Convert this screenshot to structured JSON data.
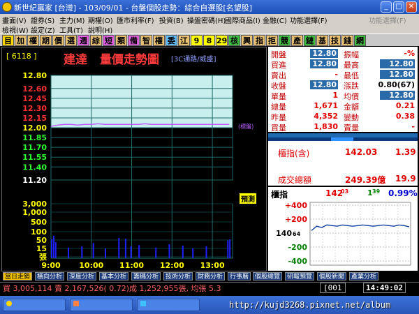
{
  "window": {
    "title": "新世紀贏家 [台灣] - 103/09/01 - 台盤個股走勢：綜合自選股[名望股]"
  },
  "menu_row1": {
    "items": [
      "畫面(V)",
      "證券(S)",
      "主力(M)",
      "期權(O)",
      "匯市利率(F)",
      "投資(B)",
      "操盤密碼(H)",
      "國際商品(I)",
      "金融(C)",
      "功能選擇(F)",
      "功能選擇(F)"
    ]
  },
  "menu_row2": {
    "items": [
      "檢視(W)",
      "設定(Z)",
      "工具(T)",
      "說明(H)"
    ]
  },
  "toolbar": {
    "buttons": [
      "目",
      "加",
      "權",
      "期",
      "價",
      "選",
      "週",
      "綜",
      "短",
      "類",
      "備",
      "智",
      "權",
      "委",
      "江",
      "9",
      "8",
      "29",
      "核",
      "興",
      "指",
      "拒",
      "競",
      "產",
      "鏈",
      "基",
      "技",
      "錢",
      "網"
    ]
  },
  "stock": {
    "code": "[ 6118 ]",
    "name": "建達",
    "chart_title": "量價走勢圖",
    "category": "[3C通路/威盛]",
    "ref_tag": "(標盤)",
    "forecast": "預測"
  },
  "chart_data": {
    "type": "line",
    "title": "量價走勢圖",
    "price_ticks": [
      "12.80",
      "12.60",
      "12.45",
      "12.30",
      "12.15",
      "12.00",
      "11.85",
      "11.70",
      "11.55",
      "11.40",
      "11.20"
    ],
    "price_tick_values": [
      12.8,
      12.6,
      12.45,
      12.3,
      12.15,
      12.0,
      11.85,
      11.7,
      11.55,
      11.4,
      11.2
    ],
    "volume_ticks": [
      "3,000",
      "1,000",
      "500",
      "100",
      "50",
      "15",
      "張"
    ],
    "time_ticks": [
      "9:00",
      "10:00",
      "11:00",
      "12:00",
      "13:00"
    ],
    "ylim": [
      11.2,
      12.8
    ],
    "reference_price": 12.0,
    "price_series": {
      "time_min": [
        0,
        10,
        20,
        30,
        40,
        50,
        60,
        70,
        80,
        90,
        100,
        110,
        120,
        130,
        140,
        150,
        160,
        170,
        180,
        190,
        200,
        210,
        220,
        230,
        240,
        250,
        265
      ],
      "price": [
        12.02,
        12.04,
        12.05,
        12.05,
        12.04,
        12.05,
        12.05,
        12.06,
        12.05,
        12.05,
        12.05,
        12.05,
        12.05,
        12.05,
        12.06,
        12.05,
        12.05,
        12.05,
        12.05,
        12.05,
        12.05,
        12.05,
        12.05,
        12.05,
        12.05,
        12.05,
        12.05
      ]
    },
    "volume_series": {
      "time_min": [
        0,
        3,
        6,
        25,
        45,
        62,
        80,
        100,
        110,
        118,
        130,
        155,
        175,
        195,
        210,
        230,
        262,
        265
      ],
      "volume": [
        30,
        60,
        18,
        6,
        8,
        15,
        5,
        40,
        35,
        8,
        10,
        6,
        12,
        9,
        5,
        8,
        25,
        30
      ]
    }
  },
  "quote": {
    "labels_left": [
      "開盤",
      "買進",
      "賣出",
      "收盤",
      "單量",
      "總量",
      "昨量",
      "買量"
    ],
    "values_left": [
      "12.80",
      "12.80",
      "-",
      "12.80",
      "1",
      "1,671",
      "4,352",
      "1,830"
    ],
    "labels_right": [
      "振幅",
      "最高",
      "最低",
      "漲跌",
      "均價",
      "金額",
      "變動",
      "賣量"
    ],
    "values_right": [
      "-%",
      "12.80",
      "12.80",
      "0.80(67)",
      "12.80",
      "0.21",
      "0.38",
      "-"
    ]
  },
  "index_panel": {
    "label": "櫃指(含)",
    "value": "142.03",
    "change": "1.39",
    "volume_label": "成交總額",
    "volume_value": "249.39億",
    "volume_change": "19.9"
  },
  "mini_chart": {
    "label": "櫃指",
    "value_main": "142",
    "value_sub": "03",
    "change_main": "1",
    "change_sub": "39",
    "pct": "0.99%",
    "center_main": "140",
    "center_sub": "64",
    "ticks": [
      "+400",
      "+200",
      "",
      "-200",
      "-400"
    ],
    "series": [
      0.55,
      0.62,
      0.6,
      0.64,
      0.63,
      0.62,
      0.64,
      0.63,
      0.62,
      0.63,
      0.64,
      0.63,
      0.62,
      0.63,
      0.64,
      0.63,
      0.62,
      0.64,
      0.63,
      0.61
    ]
  },
  "tabs": [
    "當日走勢",
    "橫向分析",
    "深度分析",
    "基本分析",
    "籌碼分析",
    "技術分析",
    "財務分析",
    "行事曆",
    "個股總覽",
    "研報預覽",
    "個股新聞",
    "產業分析"
  ],
  "status": {
    "ticker": "買 3,005,114 賣 2,167,526( 0.72)成 1,252,955張, 均張 5.3",
    "page": "[001",
    "clock": "14:49:02"
  },
  "taskbar": {
    "url": "http://kujd3268.pixnet.net/album"
  },
  "colors": {
    "price_line": "#c060ff",
    "volume_bar": "#2020ff",
    "grid": "#1f6a6a",
    "upper_fill": "#c9eeee"
  }
}
